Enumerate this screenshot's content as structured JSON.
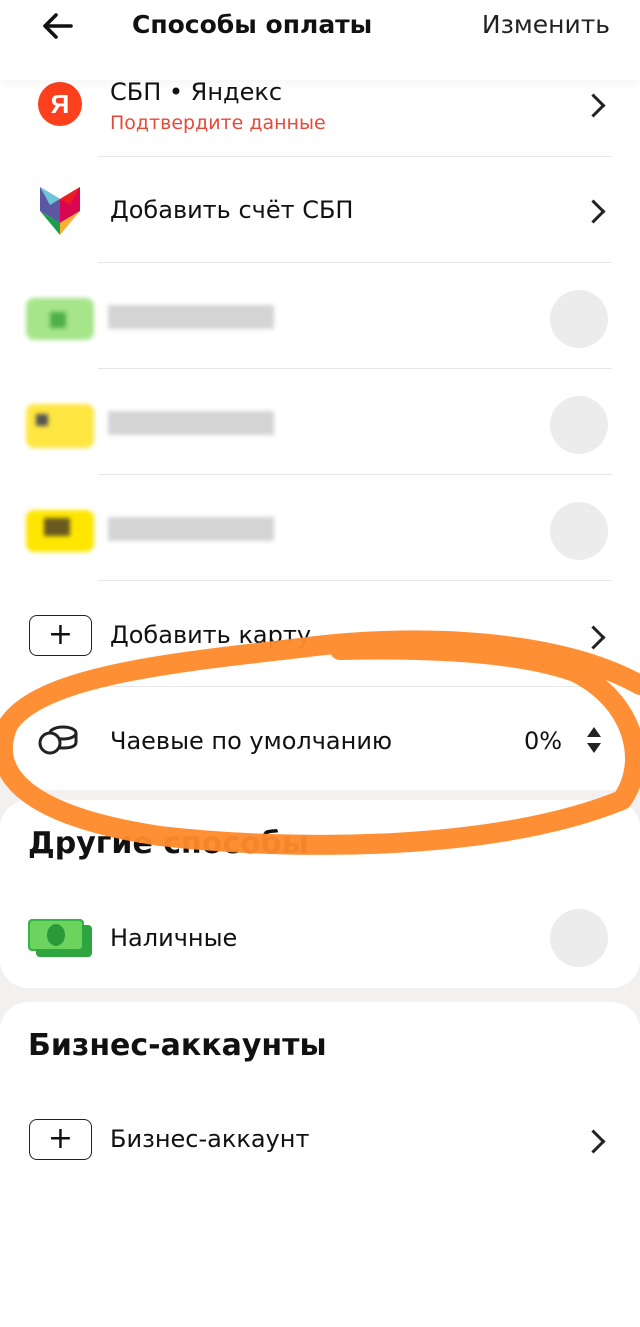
{
  "header": {
    "back_icon": "arrow-left-icon",
    "title": "Способы оплаты",
    "edit_label": "Изменить"
  },
  "methods": {
    "sbp_yandex": {
      "icon": "yandex-logo-icon",
      "label": "СБП • Яндекс",
      "sublabel": "Подтвердите данные",
      "status_color": "#e8483a"
    },
    "add_sbp": {
      "icon": "sbp-logo-icon",
      "label": "Добавить счёт СБП"
    },
    "blurred_cards": [
      {
        "icon": "card-icon",
        "color": "#9be07a"
      },
      {
        "icon": "card-icon",
        "color": "#ffe23a"
      },
      {
        "icon": "card-icon",
        "color": "#ffe600"
      }
    ],
    "add_card": {
      "icon": "plus-icon",
      "label": "Добавить карту"
    },
    "tips": {
      "icon": "coins-icon",
      "label": "Чаевые по умолчанию",
      "value": "0%"
    }
  },
  "other": {
    "title": "Другие способы",
    "cash": {
      "icon": "cash-icon",
      "label": "Наличные"
    }
  },
  "business": {
    "title": "Бизнес-аккаунты",
    "add": {
      "icon": "plus-icon",
      "label": "Бизнес-аккаунт"
    }
  },
  "colors": {
    "annotation": "#ff8a2c",
    "accent_red": "#e8483a"
  }
}
